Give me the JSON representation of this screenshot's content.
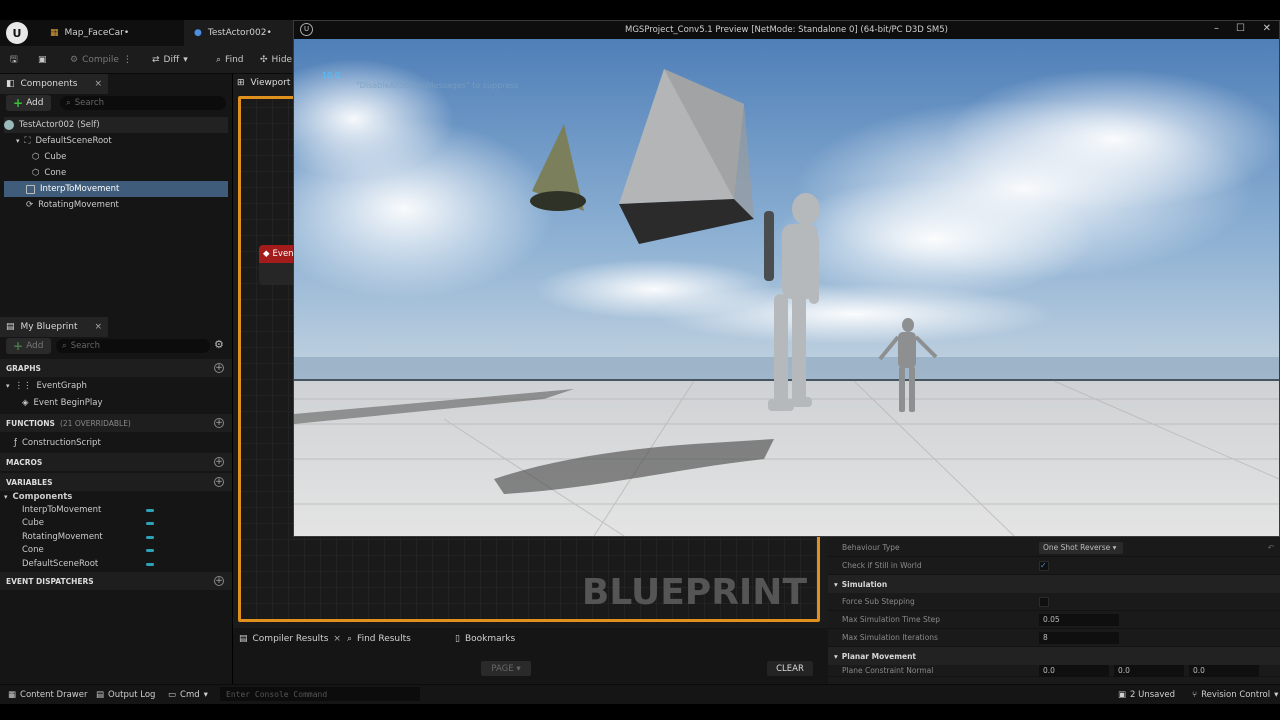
{
  "editor": {
    "tabs": [
      {
        "label": "Map_FaceCar•"
      },
      {
        "label": "TestActor002•"
      }
    ],
    "toolbar": {
      "compile": "Compile",
      "diff": "Diff",
      "find": "Find",
      "hide": "Hide"
    },
    "viewport_tab": "Viewport"
  },
  "components_panel": {
    "title": "Components",
    "add_label": "Add",
    "search_placeholder": "Search",
    "items": [
      {
        "label": "TestActor002 (Self)"
      },
      {
        "label": "DefaultSceneRoot"
      },
      {
        "label": "Cube"
      },
      {
        "label": "Cone"
      },
      {
        "label": "InterpToMovement"
      },
      {
        "label": "RotatingMovement"
      }
    ]
  },
  "my_blueprint": {
    "title": "My Blueprint",
    "add_label": "Add",
    "search_placeholder": "Search",
    "graphs_header": "GRAPHS",
    "event_graph": "EventGraph",
    "event_begin_play": "Event BeginPlay",
    "functions_header": "FUNCTIONS",
    "functions_count": "(21 OVERRIDABLE)",
    "construction_script": "ConstructionScript",
    "macros_header": "MACROS",
    "variables_header": "VARIABLES",
    "components_group": "Components",
    "variables": [
      {
        "label": "InterpToMovement"
      },
      {
        "label": "Cube"
      },
      {
        "label": "RotatingMovement"
      },
      {
        "label": "Cone"
      },
      {
        "label": "DefaultSceneRoot"
      }
    ],
    "event_dispatchers_header": "EVENT DISPATCHERS"
  },
  "graph": {
    "event_node_label": "Even",
    "watermark": "BLUEPRINT"
  },
  "results": {
    "compiler_results": "Compiler Results",
    "find_results": "Find Results",
    "bookmarks": "Bookmarks",
    "page_label": "PAGE",
    "clear_label": "CLEAR"
  },
  "details": {
    "behaviour_type_label": "Behaviour Type",
    "behaviour_type_value": "One Shot Reverse",
    "check_still_label": "Check if Still in World",
    "simulation_header": "Simulation",
    "force_sub_stepping_label": "Force Sub Stepping",
    "max_sim_time_step_label": "Max Simulation Time Step",
    "max_sim_time_step_value": "0.05",
    "max_sim_iterations_label": "Max Simulation Iterations",
    "max_sim_iterations_value": "8",
    "planar_movement_header": "Planar Movement",
    "plane_constraint_normal_label": "Plane Constraint Normal",
    "plane_constraint_normal_values": [
      "0.0",
      "0.0",
      "0.0"
    ]
  },
  "status_bar": {
    "content_drawer": "Content Drawer",
    "output_log": "Output Log",
    "cmd": "Cmd",
    "console_placeholder": "Enter Console Command",
    "unsaved": "2 Unsaved",
    "revision_control": "Revision Control"
  },
  "preview_window": {
    "title": "MGSProject_Conv5.1 Preview [NetMode: Standalone 0]  (64-bit/PC D3D SM5)",
    "stat_value": "10.0",
    "stat_message": "\"DisableAllScreenMessages\" to suppress"
  },
  "colors": {
    "accent_orange": "#e0901c",
    "selection_blue": "#3f5d7a",
    "add_green": "#39c239",
    "event_red": "#a31b1b"
  }
}
